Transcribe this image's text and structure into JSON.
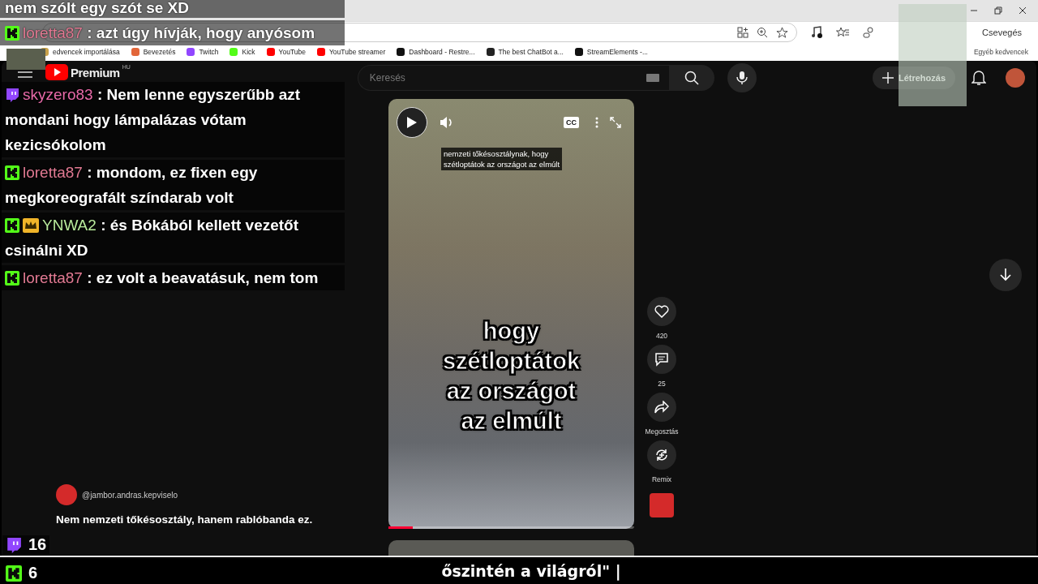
{
  "browser": {
    "bookmarks": [
      {
        "label": "edvencek importálása"
      },
      {
        "label": "Bevezetés"
      },
      {
        "label": "Twitch"
      },
      {
        "label": "Kick"
      },
      {
        "label": "YouTube"
      },
      {
        "label": "YouTube streamer"
      },
      {
        "label": "Dashboard - Restre..."
      },
      {
        "label": "The best ChatBot a..."
      },
      {
        "label": "StreamElements -..."
      }
    ],
    "other_favorites": "Egyéb kedvencek",
    "chat_button": "Csevegés"
  },
  "youtube": {
    "logo": "Premium",
    "region": "HU",
    "search": {
      "placeholder": "Keresés"
    },
    "create_button": "Létrehozás"
  },
  "short": {
    "caption": [
      "nemzeti tőkésosztálynak, hogy",
      "szétloptátok az országot az elmúlt"
    ],
    "subtitle": [
      "hogy",
      "szétloptátok",
      "az országot",
      "az elmúlt"
    ],
    "cc_label": "CC",
    "progress": {
      "level": 0.1
    },
    "actions": [
      {
        "kind": "like",
        "label": "420"
      },
      {
        "kind": "comment",
        "label": "25"
      },
      {
        "kind": "share",
        "label": "Megosztás"
      },
      {
        "kind": "remix",
        "label": "Remix"
      }
    ],
    "channel": "@jambor.andras.kepviselo",
    "title": "Nem nemzeti tőkésosztály, hanem rablóbanda ez."
  },
  "chat": [
    {
      "kind": "continuation",
      "text": "nem szólt egy szót se XD"
    },
    {
      "kind": "kick",
      "crown_badge": false,
      "username": "loretta87",
      "color": "#e27a93",
      "text": ": azt úgy hívják, hogy anyósom"
    },
    {
      "kind": "twitch",
      "crown_badge": false,
      "username": "skyzero83",
      "color": "#e86aa8",
      "text": ": Nem lenne egyszerűbb azt mondani hogy lámpalázas vótam kezicsókolom"
    },
    {
      "kind": "kick",
      "crown_badge": false,
      "username": "loretta87",
      "color": "#e27a93",
      "text": ": mondom, ez fixen egy megkoreografált színdarab volt"
    },
    {
      "kind": "kick",
      "crown_badge": true,
      "username": "YNWA2",
      "color": "#b9eb9c",
      "text": ": és Bókából kellett vezetőt csinálni XD"
    },
    {
      "kind": "kick",
      "crown_badge": false,
      "username": "loretta87",
      "color": "#e27a93",
      "text": ": ez volt a beavatásuk, nem tom"
    }
  ],
  "viewers": [
    {
      "kind": "twitch",
      "count": "16"
    },
    {
      "kind": "kick",
      "count": "6"
    }
  ],
  "ticker": "őszintén a világról\" |"
}
